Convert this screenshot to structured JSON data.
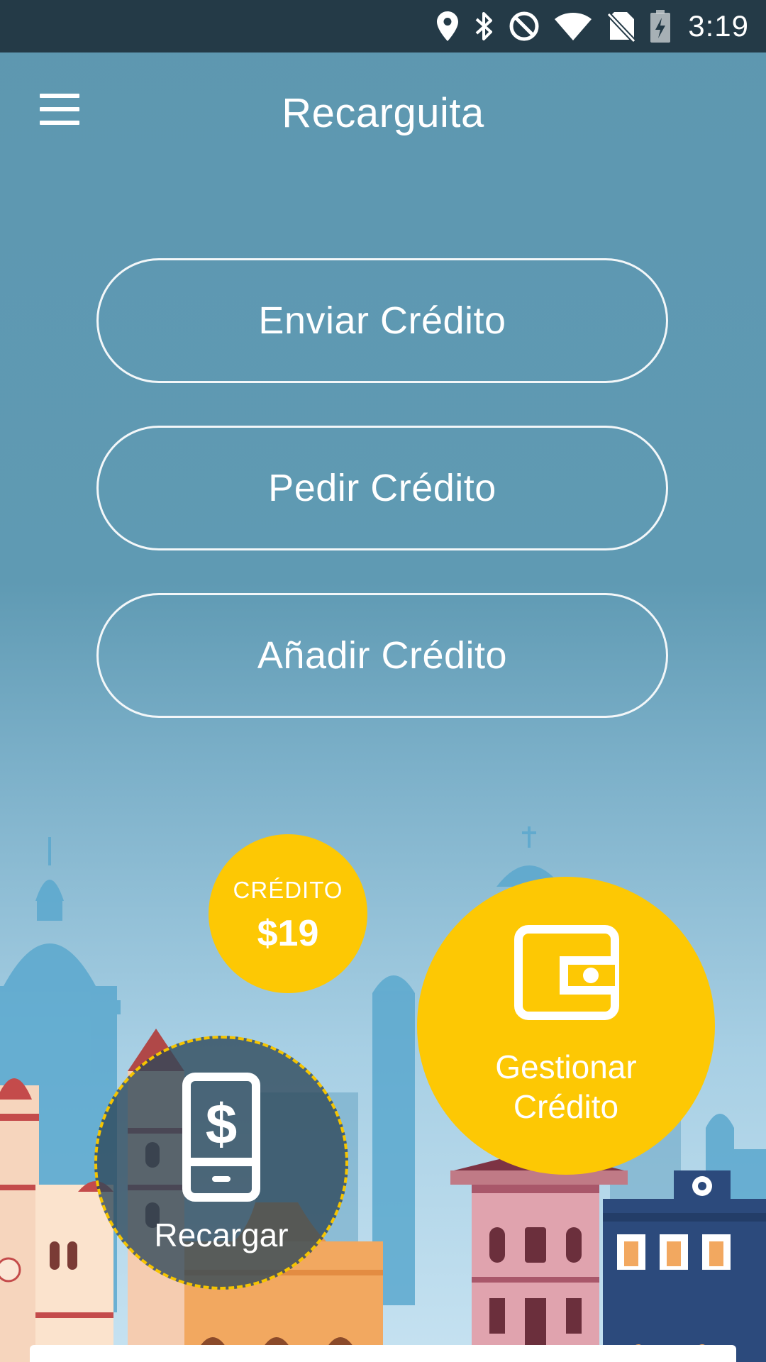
{
  "status_bar": {
    "time": "3:19",
    "icons": [
      "location-icon",
      "bluetooth-icon",
      "do-not-disturb-icon",
      "wifi-icon",
      "no-sim-icon",
      "battery-charging-icon"
    ]
  },
  "app_bar": {
    "title": "Recarguita",
    "menu_icon": "hamburger-menu-icon"
  },
  "actions": {
    "enviar": "Enviar Crédito",
    "pedir": "Pedir Crédito",
    "anadir": "Añadir Crédito"
  },
  "credit": {
    "label": "CRÉDITO",
    "amount": "$19"
  },
  "gestionar": {
    "line1": "Gestionar",
    "line2": "Crédito",
    "icon": "wallet-icon"
  },
  "recargar": {
    "label": "Recargar",
    "icon": "phone-dollar-icon"
  },
  "colors": {
    "status_bar": "#243a47",
    "background_top": "#5e97b0",
    "accent_yellow": "#fdc804",
    "recargar_fill": "#2d4658"
  }
}
